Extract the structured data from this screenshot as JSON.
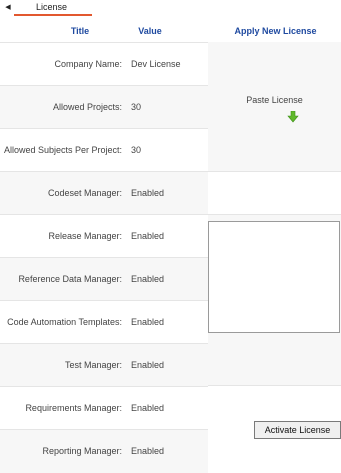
{
  "tabs": {
    "active_tab": "License"
  },
  "headers": {
    "title": "Title",
    "value": "Value",
    "apply": "Apply New License"
  },
  "rows": [
    {
      "label": "Company Name:",
      "value": "Dev License"
    },
    {
      "label": "Allowed Projects:",
      "value": "30"
    },
    {
      "label": "Allowed Subjects Per Project:",
      "value": "30"
    },
    {
      "label": "Codeset Manager:",
      "value": "Enabled"
    },
    {
      "label": "Release Manager:",
      "value": "Enabled"
    },
    {
      "label": "Reference Data Manager:",
      "value": "Enabled"
    },
    {
      "label": "Code Automation Templates:",
      "value": "Enabled"
    },
    {
      "label": "Test Manager:",
      "value": "Enabled"
    },
    {
      "label": "Requirements Manager:",
      "value": "Enabled"
    },
    {
      "label": "Reporting Manager:",
      "value": "Enabled"
    }
  ],
  "apply": {
    "paste_label": "Paste License",
    "paste_icon": "green-down-arrow-icon",
    "license_text": "",
    "activate_label": "Activate License"
  },
  "colors": {
    "header": "#1f4aa0",
    "tab_underline": "#e2582f",
    "paste_icon": "#5fb82a"
  }
}
